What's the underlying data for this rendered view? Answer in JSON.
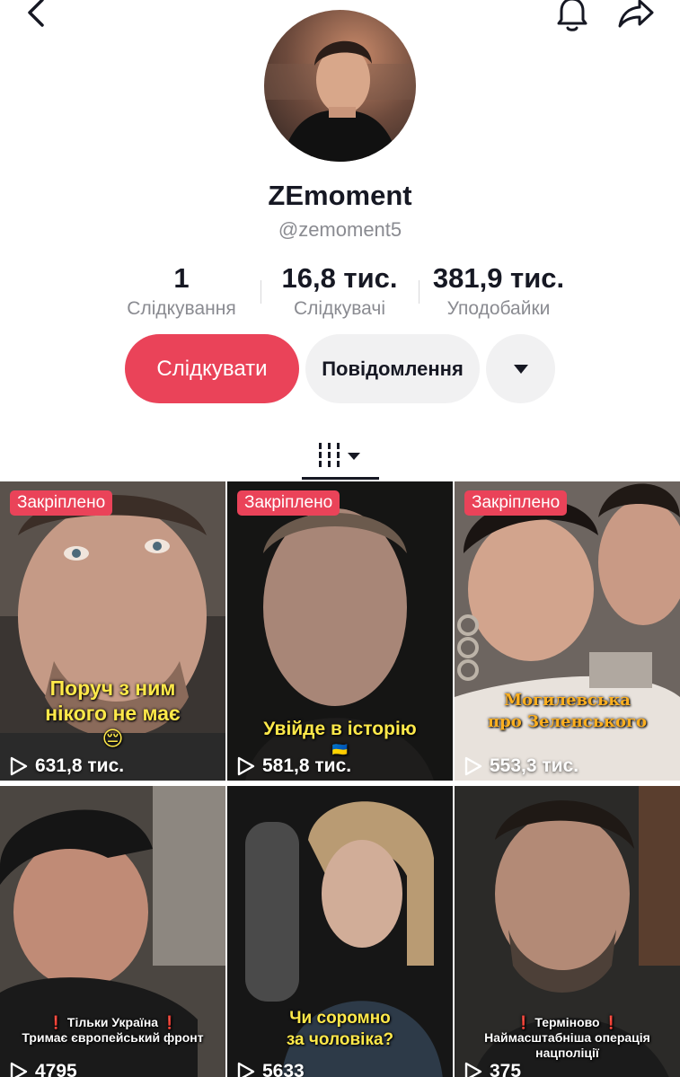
{
  "header": {
    "back_icon": "chevron-left-icon",
    "bell_icon": "bell-icon",
    "share_icon": "share-arrow-icon"
  },
  "profile": {
    "display_name": "ZEmoment",
    "handle": "@zemoment5"
  },
  "stats": {
    "following": {
      "value": "1",
      "label": "Слідкування"
    },
    "followers": {
      "value": "16,8 тис.",
      "label": "Слідкувачі"
    },
    "likes": {
      "value": "381,9 тис.",
      "label": "Уподобайки"
    }
  },
  "actions": {
    "follow_label": "Слідкувати",
    "message_label": "Повідомлення",
    "more_icon": "caret-down-icon"
  },
  "tabs": {
    "grid_icon": "grid-tab-icon"
  },
  "colors": {
    "accent": "#ea4359",
    "text": "#161823",
    "muted": "#8a8b91",
    "button_bg": "#f1f1f2"
  },
  "videos": [
    {
      "pinned_label": "Закріплено",
      "caption": [
        "Поруч з ним",
        "нікого не має",
        "😔"
      ],
      "views": "631,8 тис."
    },
    {
      "pinned_label": "Закріплено",
      "caption": [
        "Увійде в історію",
        "🇺🇦"
      ],
      "views": "581,8 тис."
    },
    {
      "pinned_label": "Закріплено",
      "caption": [
        "Могилевська",
        "про Зеленського"
      ],
      "views": "553,3 тис."
    },
    {
      "pinned_label": "",
      "caption": [
        "❗ Тільки Україна ❗",
        "Тримає європейський фронт"
      ],
      "views": "4795"
    },
    {
      "pinned_label": "",
      "caption": [
        "Чи соромно",
        "за чоловіка?"
      ],
      "views": "5633"
    },
    {
      "pinned_label": "",
      "caption": [
        "❗ Терміново ❗",
        "Наймасштабніша операція",
        "нацполіції"
      ],
      "views": "375"
    }
  ]
}
